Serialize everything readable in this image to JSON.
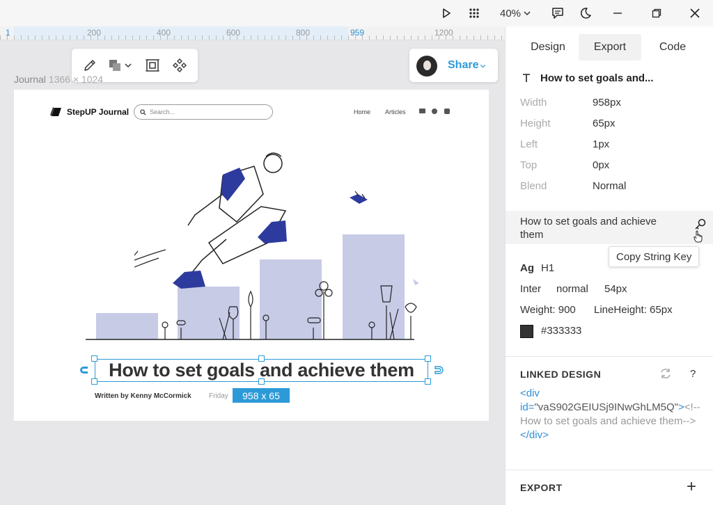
{
  "window": {
    "zoom_label": "40%",
    "icons": [
      "play-icon",
      "apps-grid-icon",
      "comment-icon",
      "dark-mode-icon",
      "minimize-icon",
      "restore-icon",
      "close-icon"
    ]
  },
  "ruler": {
    "origin": "1",
    "ticks": [
      "200",
      "400",
      "600",
      "800",
      "959",
      "1200"
    ]
  },
  "toolbar": {
    "tools": [
      "pencil-icon",
      "shapes-icon",
      "chevron-down-icon",
      "frame-icon",
      "component-icon"
    ]
  },
  "share": {
    "label": "Share"
  },
  "frame": {
    "name": "Journal",
    "size": "1366 × 1024"
  },
  "artboard": {
    "brand": "StepUP Journal",
    "search_placeholder": "Search...",
    "nav": [
      "Home",
      "Articles"
    ],
    "headline": "How to set goals and achieve them",
    "byline": "Written by Kenny McCormick",
    "date": "Friday",
    "dimension_badge": "958 x 65",
    "colors": {
      "accent": "#2d9ad8",
      "illustration_blue": "#2e3b9e",
      "bars": "#c7cbe6"
    }
  },
  "panel": {
    "tabs": [
      "Design",
      "Export",
      "Code"
    ],
    "active_tab": "Export",
    "layer_name": "How to set goals and...",
    "props": [
      {
        "k": "Width",
        "v": "958px"
      },
      {
        "k": "Height",
        "v": "65px"
      },
      {
        "k": "Left",
        "v": "1px"
      },
      {
        "k": "Top",
        "v": "0px"
      },
      {
        "k": "Blend",
        "v": "Normal"
      }
    ],
    "string_value": "How to set goals and achieve them",
    "tooltip": "Copy String Key",
    "typography": {
      "ag": "Ag",
      "tag": "H1",
      "family": "Inter",
      "style": "normal",
      "size": "54px",
      "weight": "Weight: 900",
      "line_height": "LineHeight: 65px",
      "color": "#333333"
    },
    "linked_design": {
      "title": "LINKED DESIGN",
      "help": "?",
      "code_open": "<div",
      "attr_name": "id=",
      "attr_value": "\"vaS902GEIUSj9INwGhLM5Q\"",
      "code_gt": ">",
      "comment": "<!--How to set goals and achieve them-->",
      "code_close": "</div>"
    },
    "export": {
      "title": "EXPORT",
      "add": "+"
    }
  }
}
